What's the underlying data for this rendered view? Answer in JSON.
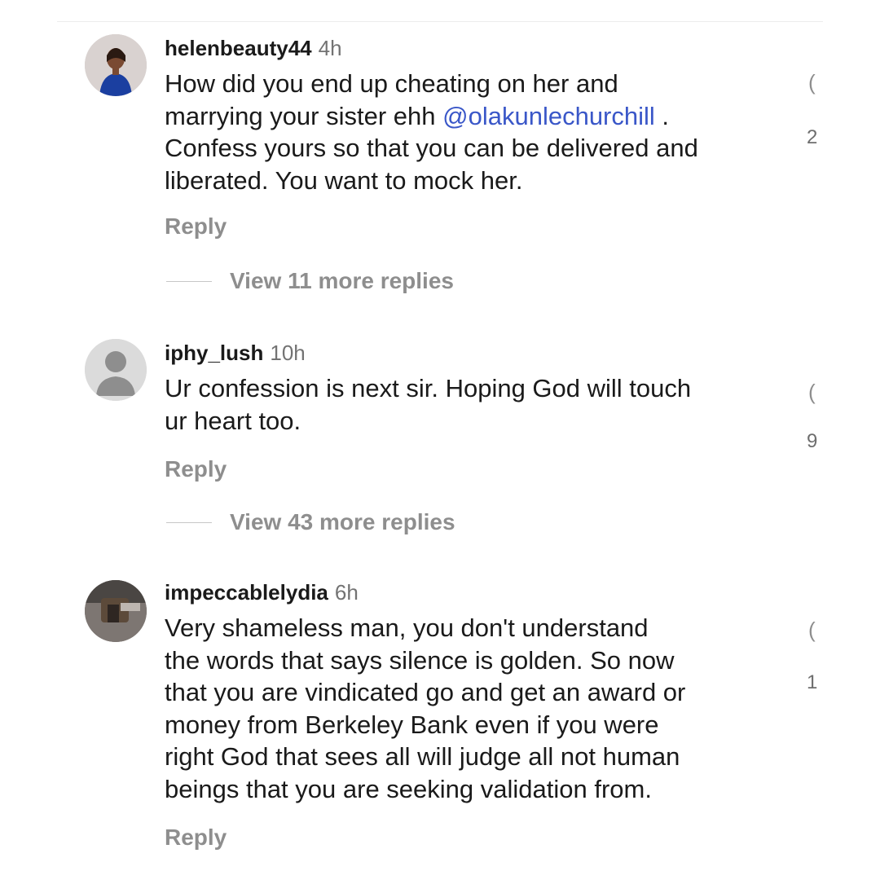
{
  "comments": [
    {
      "username": "helenbeauty44",
      "time": "4h",
      "text_parts": {
        "before": "How did you end up cheating on her and\nmarrying your sister ehh ",
        "mention": "@olakunlechurchill",
        "after": " .\nConfess yours so that you can be delivered and\nliberated. You want to mock her."
      },
      "reply_label": "Reply",
      "view_replies_label": "View 11 more replies",
      "like_icon": "heart-icon",
      "like_count": "2",
      "like_glyph": "("
    },
    {
      "username": "iphy_lush",
      "time": "10h",
      "text": "Ur confession is next sir. Hoping God will touch\nur heart too.",
      "reply_label": "Reply",
      "view_replies_label": "View 43 more replies",
      "like_icon": "heart-icon",
      "like_count": "9",
      "like_glyph": "("
    },
    {
      "username": "impeccablelydia",
      "time": "6h",
      "text": "Very shameless man,  you don't understand\nthe words that says silence is golden. So now\nthat you are vindicated go and get an award or\nmoney from Berkeley Bank even if you were\nright God that sees all will judge all  not human\nbeings that you are seeking  validation from.",
      "reply_label": "Reply",
      "like_icon": "heart-icon",
      "like_count": "1",
      "like_glyph": "("
    }
  ],
  "colors": {
    "mention": "#3a57c8",
    "secondary_text": "#8e8e8e",
    "primary_text": "#1a1a1a"
  }
}
